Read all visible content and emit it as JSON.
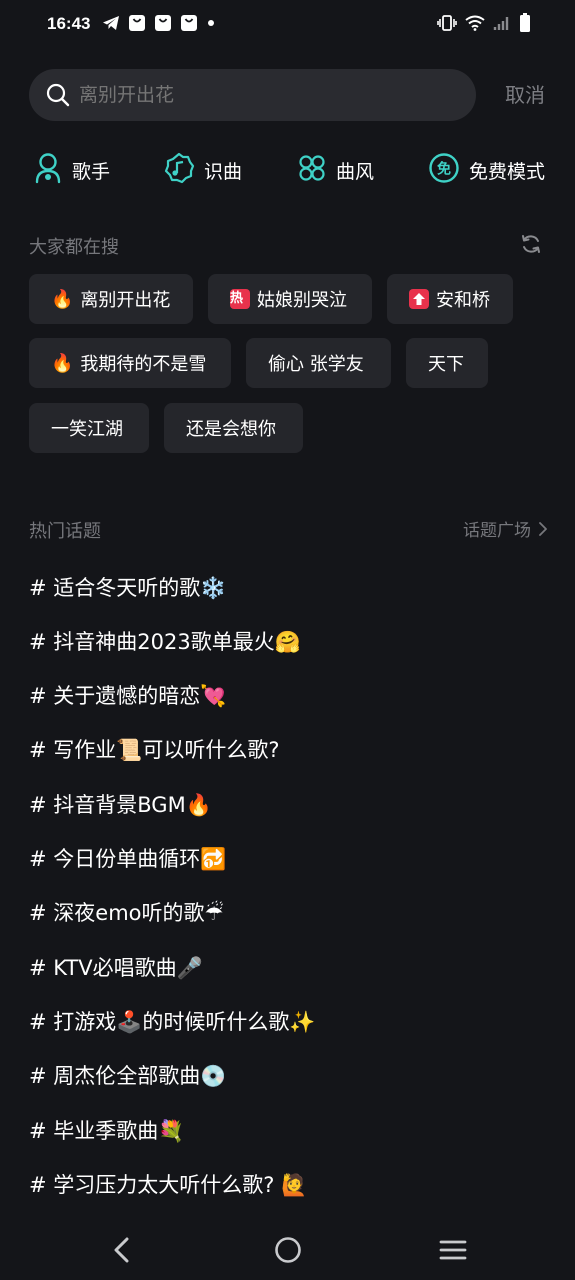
{
  "status_bar": {
    "time": "16:43"
  },
  "search": {
    "placeholder": "离别开出花",
    "cancel_label": "取消"
  },
  "quick_actions": [
    {
      "label": "歌手",
      "icon": "singer-icon"
    },
    {
      "label": "识曲",
      "icon": "music-recognition-icon"
    },
    {
      "label": "曲风",
      "icon": "genre-icon"
    },
    {
      "label": "免费模式",
      "icon": "free-mode-icon"
    }
  ],
  "hot_search": {
    "title": "大家都在搜",
    "items": [
      {
        "label": "离别开出花",
        "icon": "fire-icon"
      },
      {
        "label": "姑娘别哭泣",
        "icon": "hot-badge-icon",
        "badge_text": "热"
      },
      {
        "label": "安和桥",
        "icon": "rising-badge-icon"
      },
      {
        "label": "我期待的不是雪",
        "icon": "fire-icon"
      },
      {
        "label": "偷心 张学友",
        "icon": ""
      },
      {
        "label": "天下",
        "icon": ""
      },
      {
        "label": "一笑江湖",
        "icon": ""
      },
      {
        "label": "还是会想你",
        "icon": ""
      }
    ]
  },
  "hot_topics": {
    "title": "热门话题",
    "more_label": "话题广场",
    "items": [
      "# 适合冬天听的歌❄️",
      "# 抖音神曲2023歌单最火🤗",
      "# 关于遗憾的暗恋💘",
      "# 写作业📜可以听什么歌?",
      "# 抖音背景BGM🔥",
      "# 今日份单曲循环🔂",
      "# 深夜emo听的歌☔",
      "# KTV必唱歌曲🎤",
      "# 打游戏🕹️的时候听什么歌✨",
      "# 周杰伦全部歌曲💿",
      "# 毕业季歌曲💐",
      "# 学习压力太大听什么歌? 🙋"
    ]
  },
  "colors": {
    "background": "#141519",
    "accent": "#3fd2c7",
    "hot_badge": "#e8324c"
  }
}
